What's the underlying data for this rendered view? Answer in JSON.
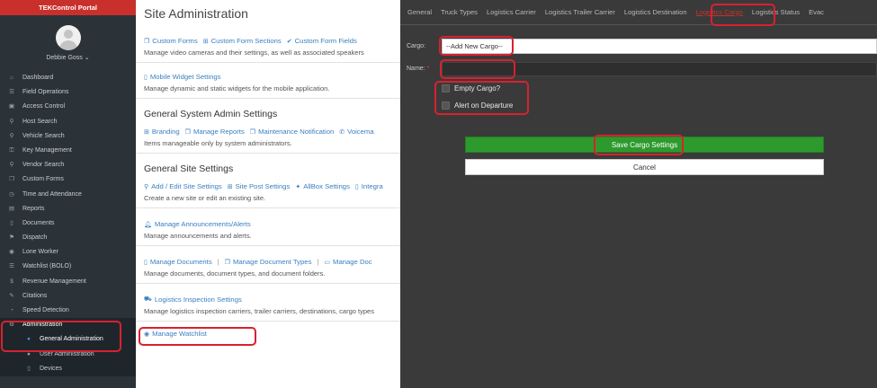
{
  "portal_title": "TEKControl Portal",
  "user": {
    "name": "Debbie Goss",
    "chevron": "chevron-down-icon"
  },
  "nav": [
    {
      "label": "Dashboard",
      "icon": "home-icon"
    },
    {
      "label": "Field Operations",
      "icon": "list-icon"
    },
    {
      "label": "Access Control",
      "icon": "lock-icon"
    },
    {
      "label": "Host Search",
      "icon": "search-icon"
    },
    {
      "label": "Vehicle Search",
      "icon": "search-icon"
    },
    {
      "label": "Key Management",
      "icon": "key-icon"
    },
    {
      "label": "Vendor Search",
      "icon": "search-icon"
    },
    {
      "label": "Custom Forms",
      "icon": "copy-icon"
    },
    {
      "label": "Time and Attendance",
      "icon": "clock-icon"
    },
    {
      "label": "Reports",
      "icon": "chart-icon"
    },
    {
      "label": "Documents",
      "icon": "file-icon"
    },
    {
      "label": "Dispatch",
      "icon": "dispatch-icon"
    },
    {
      "label": "Lone Worker",
      "icon": "person-icon"
    },
    {
      "label": "Watchlist (BOLO)",
      "icon": "list-icon"
    },
    {
      "label": "Revenue Management",
      "icon": "dollar-icon"
    },
    {
      "label": "Citations",
      "icon": "pencil-icon"
    },
    {
      "label": "Speed Detection",
      "icon": "gauge-icon"
    },
    {
      "label": "Administration",
      "icon": "gears-icon"
    }
  ],
  "subnav": [
    {
      "label": "General Administration",
      "icon": "users-icon"
    },
    {
      "label": "User Administration",
      "icon": "users-icon"
    },
    {
      "label": "Devices",
      "icon": "device-icon"
    }
  ],
  "main": {
    "title": "Site Administration",
    "s1": {
      "links": [
        "Custom Forms",
        "Custom Form Sections",
        "Custom Form Fields"
      ],
      "desc": "Manage video cameras and their settings, as well as associated speakers"
    },
    "s2": {
      "links": [
        "Mobile Widget Settings"
      ],
      "desc": "Manage dynamic and static widgets for the mobile application."
    },
    "s3": {
      "heading": "General System Admin Settings",
      "links": [
        "Branding",
        "Manage Reports",
        "Maintenance Notification",
        "Voicema"
      ],
      "desc": "Items manageable only by system administrators."
    },
    "s4": {
      "heading": "General Site Settings",
      "links": [
        "Add / Edit Site Settings",
        "Site Post Settings",
        "AllBox Settings",
        "Integra"
      ],
      "desc": "Create a new site or edit an existing site."
    },
    "s5": {
      "links": [
        "Manage Announcements/Alerts"
      ],
      "desc": "Manage announcements and alerts."
    },
    "s6": {
      "links": [
        "Manage Documents",
        "Manage Document Types",
        "Manage Doc"
      ],
      "desc": "Manage documents, document types, and document folders."
    },
    "s7": {
      "links": [
        "Logistics Inspection Settings"
      ],
      "desc": "Manage logistics inspection carriers, trailer carriers, destinations, cargo types"
    },
    "s8": {
      "links": [
        "Manage Watchlist"
      ]
    }
  },
  "panel": {
    "tabs": [
      "General",
      "Truck Types",
      "Logistics Carrier",
      "Logistics Trailer Carrier",
      "Logistics Destination",
      "Logistics Cargo",
      "Logistics Status",
      "Evac"
    ],
    "active_tab": "Logistics Cargo",
    "cargo_label": "Cargo:",
    "cargo_value": "--Add New Cargo--",
    "name_label": "Name:",
    "name_required": "*",
    "name_value": "",
    "empty_cargo_label": "Empty Cargo?",
    "alert_label": "Alert on Departure",
    "save_label": "Save Cargo Settings",
    "cancel_label": "Cancel"
  },
  "colors": {
    "highlight": "#d8212f",
    "save": "#2d9a2d",
    "portal": "#c9302c",
    "link": "#3a7fc1"
  }
}
